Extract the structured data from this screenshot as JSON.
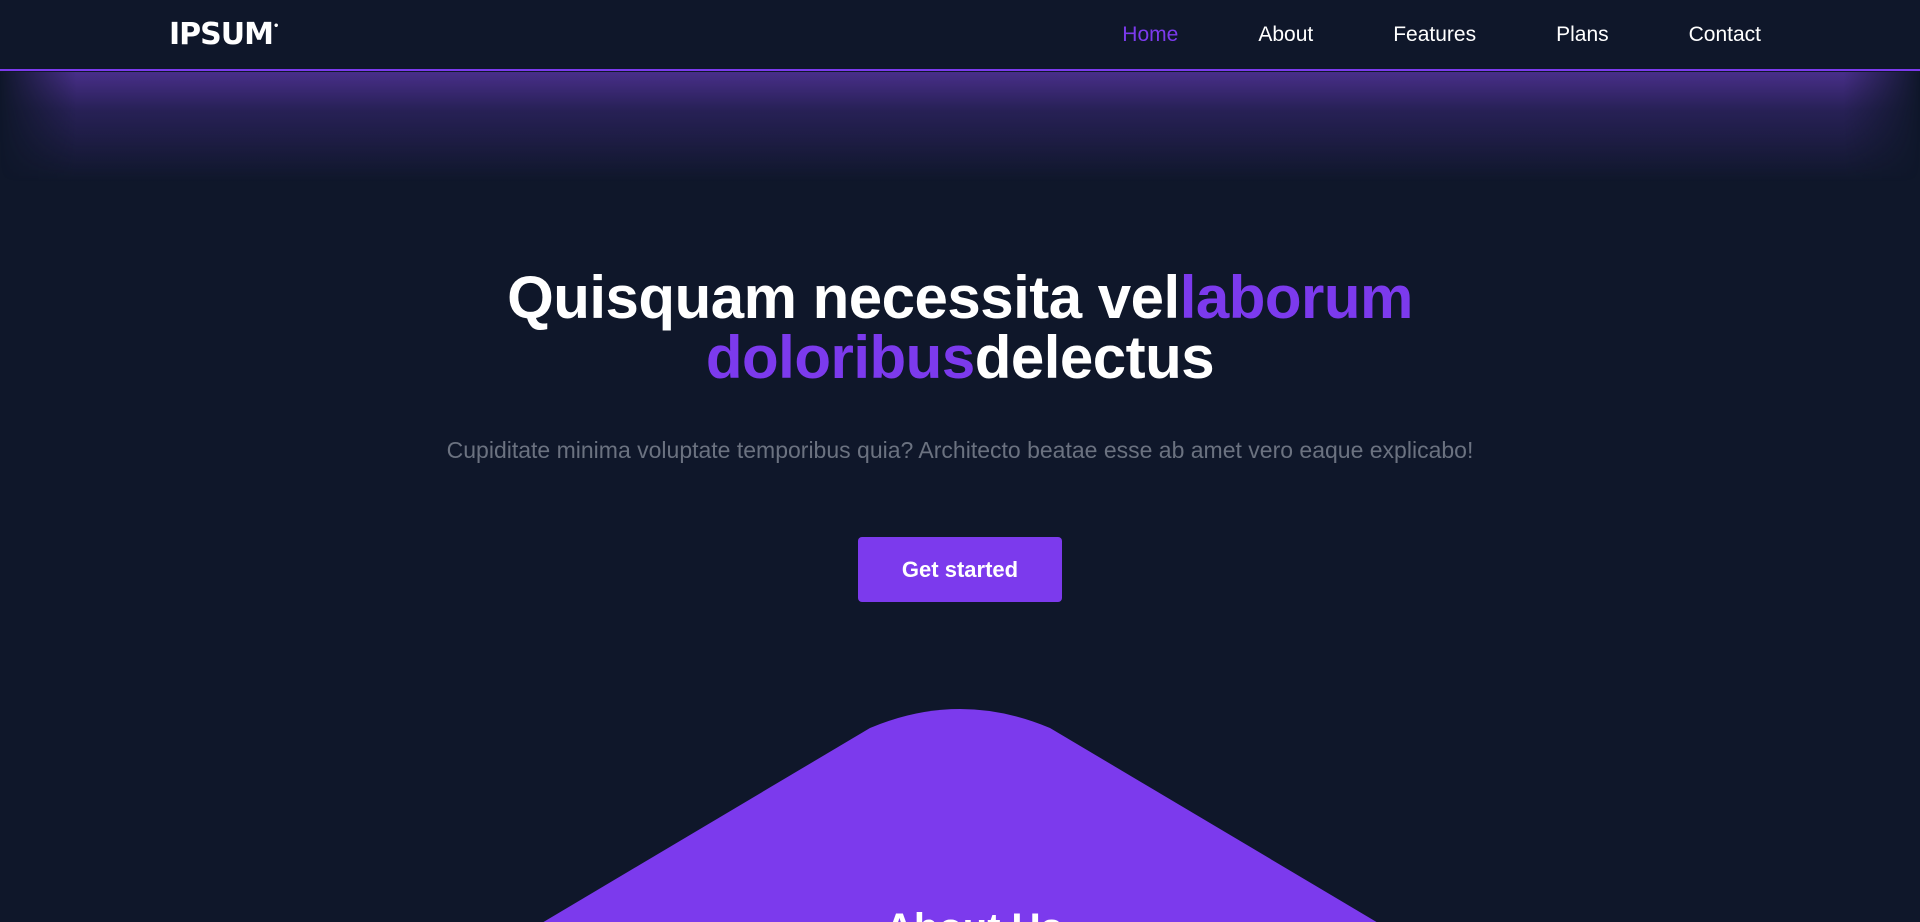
{
  "brand": {
    "logo_text": "IPSUM",
    "logo_mark": "•"
  },
  "nav": {
    "items": [
      {
        "label": "Home",
        "active": true
      },
      {
        "label": "About",
        "active": false
      },
      {
        "label": "Features",
        "active": false
      },
      {
        "label": "Plans",
        "active": false
      },
      {
        "label": "Contact",
        "active": false
      }
    ]
  },
  "hero": {
    "title_part1": "Quisquam necessita vel",
    "title_accent1": "laborum",
    "title_accent2": "doloribus",
    "title_part2": "delectus",
    "subtitle": "Cupiditate minima voluptate temporibus quia? Architecto beatae esse ab amet vero eaque explicabo!",
    "cta_label": "Get started"
  },
  "section_peek": {
    "heading": "About Us"
  },
  "colors": {
    "background": "#0f172a",
    "accent": "#7c3aed",
    "text_primary": "#ffffff",
    "text_muted": "#6b7280"
  }
}
